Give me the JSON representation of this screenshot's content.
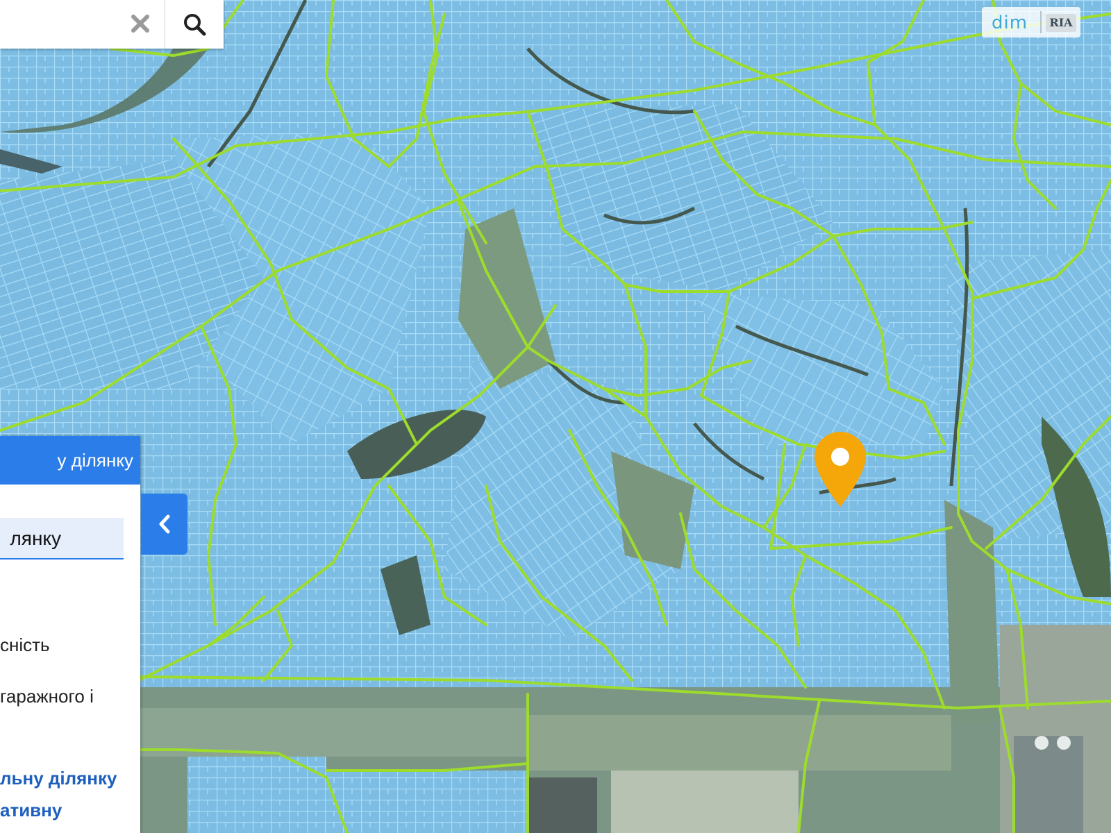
{
  "search": {
    "value": "",
    "placeholder": "",
    "clear_icon": "close-icon",
    "search_icon": "search-icon"
  },
  "watermark": {
    "brand_left": "dim",
    "brand_right": "RIA"
  },
  "panel": {
    "header": "у ділянку",
    "input_value": "лянку",
    "line_1": "сність",
    "line_2": "гаражного і",
    "link_1": "льну ділянку",
    "link_2": "ативну",
    "collapse_icon": "chevron-left-icon"
  },
  "colors": {
    "parcel_fill": "#7fbfe6",
    "parcel_line": "#8fd0f5",
    "boundary": "#9bdc2a",
    "marker": "#f5a70a",
    "panel_accent": "#2b7de9"
  },
  "marker": {
    "icon": "location-pin-icon"
  }
}
